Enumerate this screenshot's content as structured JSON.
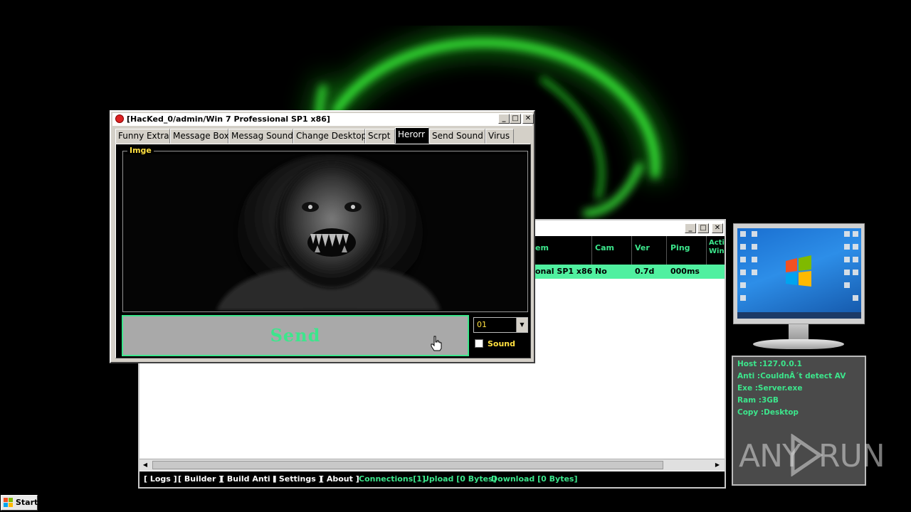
{
  "front_window": {
    "title": "[HacKed_0/admin/Win 7 Professional SP1 x86]",
    "tabs": [
      "Funny Extra",
      "Message Box",
      "Messag Sound",
      "Change Desktop",
      "Scrpt",
      "Herorr",
      "Send Sound",
      "Virus"
    ],
    "active_tab": "Herorr",
    "group_label": "Imge",
    "send_label": "Send",
    "combo_value": "01",
    "sound_label": "Sound",
    "sound_checked": false
  },
  "main_window": {
    "columns": [
      "em",
      "Cam",
      "Ver",
      "Ping",
      "Acti\nWin"
    ],
    "row": [
      "onal SP1 x86",
      "No",
      "0.7d",
      "000ms"
    ],
    "status_links": [
      "[ Logs ]",
      "[ Builder ]",
      "[ Build Anti ]",
      "[ Settings ]",
      "[ About ]"
    ],
    "status_info": [
      "Connections[1]",
      "Upload [0 Bytes]",
      "Download [0 Bytes]"
    ]
  },
  "info_panel": {
    "lines": [
      "Host :127.0.0.1",
      "Anti :CouldnÂ´t detect AV",
      "Exe :Server.exe",
      "Ram :3GB",
      "Copy :Desktop"
    ]
  },
  "watermark": {
    "left": "ANY",
    "right": "RUN"
  },
  "taskbar": {
    "start_label": "Start"
  },
  "colors": {
    "accent_green": "#3ce68c",
    "label_yellow": "#ffe040",
    "row_green": "#50f0a0"
  }
}
